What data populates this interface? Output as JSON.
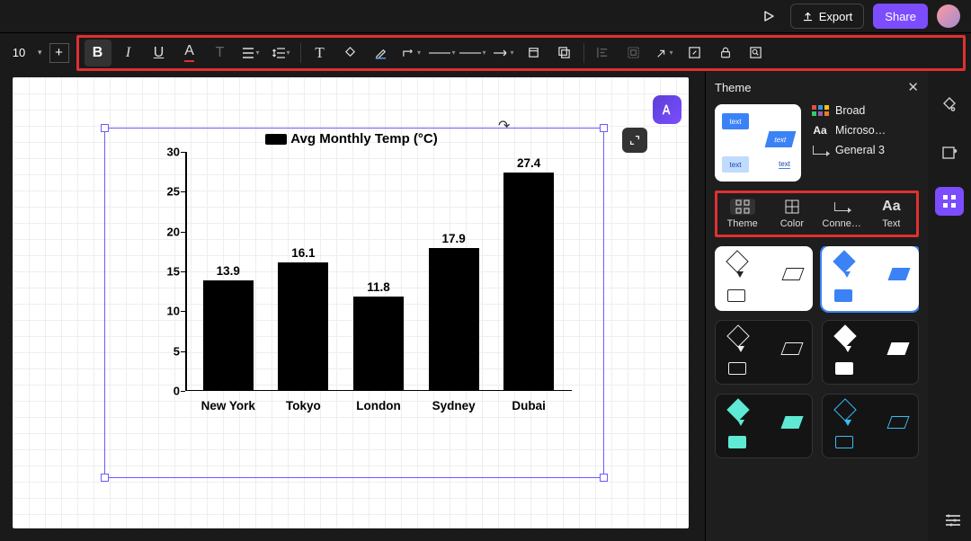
{
  "header": {
    "export_label": "Export",
    "share_label": "Share"
  },
  "toolbar": {
    "font_size": "10"
  },
  "panel": {
    "title": "Theme",
    "attrs": {
      "color_label": "Broad",
      "font_label": "Microso…",
      "connector_label": "General 3"
    },
    "tabs": {
      "theme": "Theme",
      "color": "Color",
      "connector": "Conne…",
      "text": "Text"
    },
    "preview_text": "text"
  },
  "chart_data": {
    "type": "bar",
    "title": "Avg Monthly Temp (°C)",
    "categories": [
      "New York",
      "Tokyo",
      "London",
      "Sydney",
      "Dubai"
    ],
    "values": [
      13.9,
      16.1,
      11.8,
      17.9,
      27.4
    ],
    "ylim": [
      0,
      30
    ],
    "yticks": [
      0,
      5,
      10,
      15,
      20,
      25,
      30
    ],
    "xlabel": "",
    "ylabel": ""
  }
}
